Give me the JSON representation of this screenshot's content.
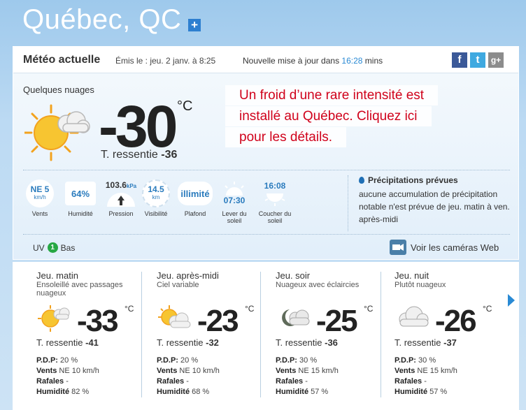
{
  "city": {
    "name": "Québec, QC",
    "add_symbol": "+"
  },
  "header": {
    "title": "Météo actuelle",
    "issued": "Émis le : jeu. 2 janv. à 8:25",
    "update_prefix": "Nouvelle mise à jour dans",
    "update_time": "16:28",
    "update_suffix": "mins",
    "social": {
      "facebook": "f",
      "twitter": "t",
      "google": "g+"
    }
  },
  "current": {
    "condition": "Quelques nuages",
    "temp": "-30",
    "unit": "°C",
    "feels_label": "T. ressentie",
    "feels_value": "-36"
  },
  "alert": {
    "lines": [
      "Un froid d’une rare intensité est",
      "installé au Québec. Cliquez ici",
      "pour les détails."
    ],
    "color": "#d0021b"
  },
  "stats": {
    "wind": {
      "value": "NE 5",
      "unit": "km/h",
      "label": "Vents"
    },
    "humidity": {
      "value": "64%",
      "label": "Humidité"
    },
    "pressure": {
      "value": "103.6",
      "unit": "kPa",
      "label": "Pression"
    },
    "visibility": {
      "value": "14.5",
      "unit": "km",
      "label": "Visibilité"
    },
    "ceiling": {
      "value": "illimité",
      "label": "Plafond"
    },
    "sunrise": {
      "value": "07:30",
      "label": "Lever du soleil"
    },
    "sunset": {
      "value": "16:08",
      "label": "Coucher du soleil"
    }
  },
  "precip": {
    "title": "Précipitations prévues",
    "text": "aucune accumulation de précipitation notable n'est prévue de jeu. matin à ven. après-midi"
  },
  "uv": {
    "label": "UV",
    "index": "1",
    "level": "Bas"
  },
  "cameras": {
    "label": "Voir les caméras Web"
  },
  "forecast": [
    {
      "period": "Jeu. matin",
      "desc": "Ensoleillé avec passages nuageux",
      "temp": "-33",
      "unit": "°C",
      "feels_label": "T. ressentie",
      "feels": "-41",
      "pdp_label": "P.D.P:",
      "pdp": "20 %",
      "wind_label": "Vents",
      "wind": "NE 10 km/h",
      "gust_label": "Rafales",
      "gust": "-",
      "hum_label": "Humidité",
      "hum": "82 %",
      "icon": "sun-cloud-icon"
    },
    {
      "period": "Jeu. après-midi",
      "desc": "Ciel variable",
      "temp": "-23",
      "unit": "°C",
      "feels_label": "T. ressentie",
      "feels": "-32",
      "pdp_label": "P.D.P:",
      "pdp": "20 %",
      "wind_label": "Vents",
      "wind": "NE 10 km/h",
      "gust_label": "Rafales",
      "gust": "-",
      "hum_label": "Humidité",
      "hum": "68 %",
      "icon": "sun-cloud-icon"
    },
    {
      "period": "Jeu. soir",
      "desc": "Nuageux avec éclaircies",
      "temp": "-25",
      "unit": "°C",
      "feels_label": "T. ressentie",
      "feels": "-36",
      "pdp_label": "P.D.P:",
      "pdp": "30 %",
      "wind_label": "Vents",
      "wind": "NE 15 km/h",
      "gust_label": "Rafales",
      "gust": "-",
      "hum_label": "Humidité",
      "hum": "57 %",
      "icon": "moon-cloud-icon"
    },
    {
      "period": "Jeu. nuit",
      "desc": "Plutôt nuageux",
      "temp": "-26",
      "unit": "°C",
      "feels_label": "T. ressentie",
      "feels": "-37",
      "pdp_label": "P.D.P:",
      "pdp": "30 %",
      "wind_label": "Vents",
      "wind": "NE 15 km/h",
      "gust_label": "Rafales",
      "gust": "-",
      "hum_label": "Humidité",
      "hum": "57 %",
      "icon": "cloud-icon"
    }
  ]
}
